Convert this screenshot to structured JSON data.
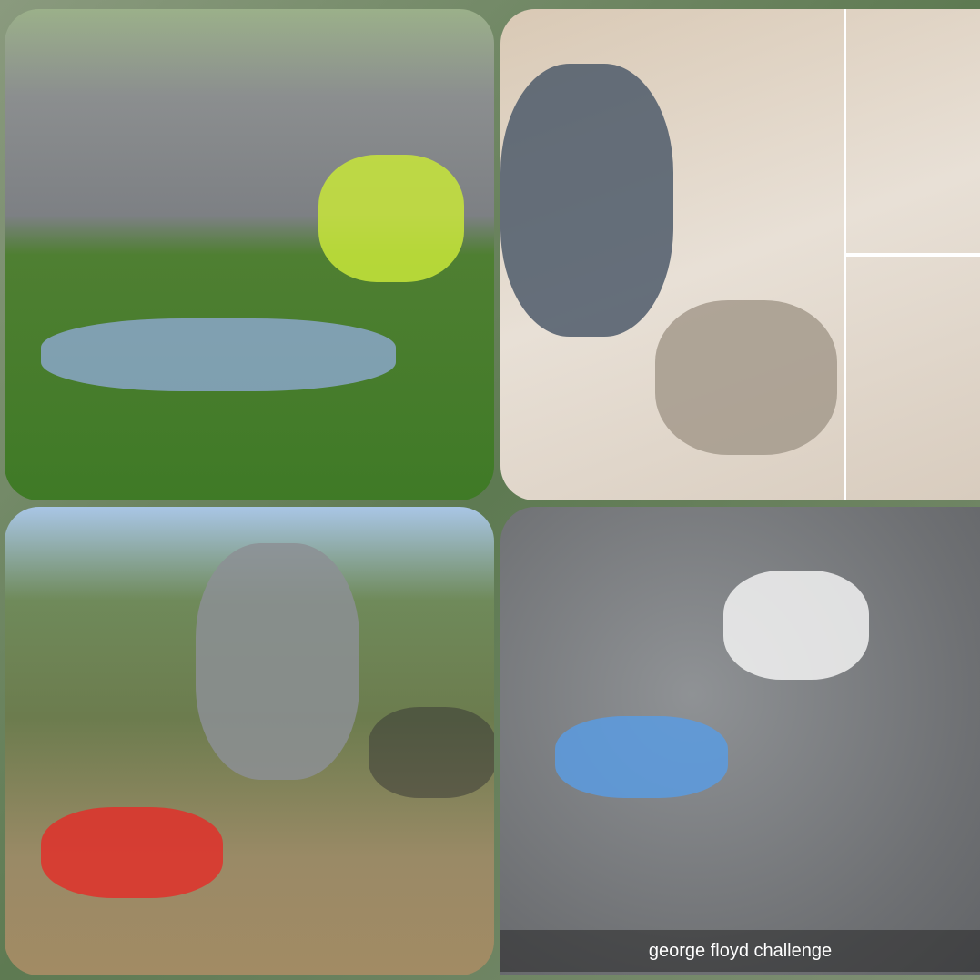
{
  "collage": {
    "caption": "george floyd challenge"
  }
}
